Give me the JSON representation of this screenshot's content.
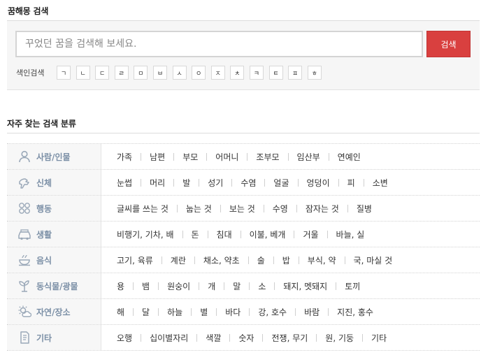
{
  "page": {
    "title": "꿈해몽 검색",
    "search_placeholder": "꾸었던 꿈을 검색해 보세요.",
    "search_button": "검색",
    "index_label": "색인검색",
    "index_keys": [
      "ㄱ",
      "ㄴ",
      "ㄷ",
      "ㄹ",
      "ㅁ",
      "ㅂ",
      "ㅅ",
      "ㅇ",
      "ㅈ",
      "ㅊ",
      "ㅋ",
      "ㅌ",
      "ㅍ",
      "ㅎ"
    ]
  },
  "categories_section": {
    "title": "자주 찾는 검색 분류",
    "rows": [
      {
        "icon": "person-icon",
        "name": "사람/인물",
        "items": [
          "가족",
          "남편",
          "부모",
          "어머니",
          "조부모",
          "임산부",
          "연예인"
        ]
      },
      {
        "icon": "hand-icon",
        "name": "신체",
        "items": [
          "눈썹",
          "머리",
          "발",
          "성기",
          "수염",
          "얼굴",
          "엉덩이",
          "피",
          "소변"
        ]
      },
      {
        "icon": "activity-icon",
        "name": "행동",
        "items": [
          "글씨를 쓰는 것",
          "눕는 것",
          "보는 것",
          "수영",
          "잠자는 것",
          "질병"
        ]
      },
      {
        "icon": "car-icon",
        "name": "생활",
        "items": [
          "비행기, 기차, 배",
          "돈",
          "침대",
          "이불, 베개",
          "거울",
          "바늘, 실"
        ]
      },
      {
        "icon": "food-icon",
        "name": "음식",
        "items": [
          "고기, 육류",
          "계란",
          "채소, 약초",
          "술",
          "밥",
          "부식, 약",
          "국, 마실 것"
        ]
      },
      {
        "icon": "plant-icon",
        "name": "동식물/광물",
        "items": [
          "용",
          "뱀",
          "원숭이",
          "개",
          "말",
          "소",
          "돼지, 멧돼지",
          "토끼"
        ]
      },
      {
        "icon": "weather-icon",
        "name": "자연/장소",
        "items": [
          "해",
          "달",
          "하늘",
          "별",
          "바다",
          "강, 호수",
          "바람",
          "지진, 홍수"
        ]
      },
      {
        "icon": "document-icon",
        "name": "기타",
        "items": [
          "오행",
          "십이별자리",
          "색깔",
          "숫자",
          "전쟁, 무기",
          "원, 기둥",
          "기타"
        ]
      }
    ]
  },
  "colors": {
    "accent": "#d9403f",
    "category_label": "#7b8fa6",
    "icon": "#9aa8b8"
  }
}
